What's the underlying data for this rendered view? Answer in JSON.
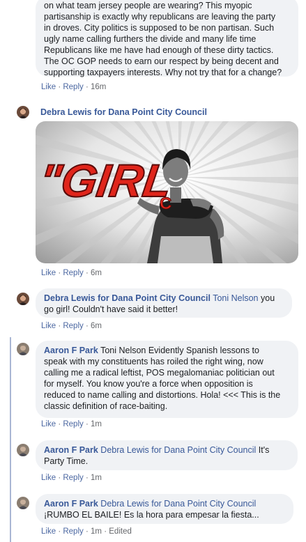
{
  "comments": [
    {
      "text_lines": [
        "on what team jersey people are wearing? This myopic",
        "partisanship is exactly why republicans are leaving the party",
        "in droves. City politics is supposed to be non partisan. Such",
        "ugly name calling furthers the divide and many life time",
        "Republicans like me have had enough of these dirty tactics.",
        "The OC GOP needs to earn our respect by being decent and",
        "supporting taxpayers interests. Why not try that for a change?"
      ],
      "like": "Like",
      "reply": "Reply",
      "time": "16m"
    },
    {
      "author": "Debra Lewis for Dana Point City Council",
      "image_text": "\"GIRL",
      "image_text_small": "C",
      "like": "Like",
      "reply": "Reply",
      "time": "6m"
    },
    {
      "author": "Debra Lewis for Dana Point City Council",
      "mention": "Toni Nelson",
      "text_after_mention": " you",
      "text_lines": [
        "go girl! Couldn't have said it better!"
      ],
      "like": "Like",
      "reply": "Reply",
      "time": "6m"
    },
    {
      "author": "Aaron F Park",
      "text_lines": [
        "Toni Nelson Evidently Spanish lessons to",
        "speak with my constituents has roiled the right wing, now",
        "calling me a radical leftist, POS megalomaniac politician out",
        "for myself. You know you're a force when opposition is",
        "reduced to name calling and distortions. Hola! <<< This is the",
        "classic definition of race-baiting."
      ],
      "like": "Like",
      "reply": "Reply",
      "time": "1m"
    },
    {
      "author": "Aaron F Park",
      "mention": "Debra Lewis for Dana Point City Council",
      "text_after_mention": " It's",
      "text_lines": [
        "Party Time."
      ],
      "like": "Like",
      "reply": "Reply",
      "time": "1m"
    },
    {
      "author": "Aaron F Park",
      "mention": "Debra Lewis for Dana Point City Council",
      "text_lines": [
        "¡RUMBO EL BAILE! Es la hora para empesar la fiesta..."
      ],
      "like": "Like",
      "reply": "Reply",
      "time": "1m",
      "edited": "Edited"
    }
  ],
  "separator": "·",
  "colors": {
    "link": "#385898",
    "bubble": "#f0f2f5",
    "meta": "#65676b",
    "thread_line": "#a9b6d4",
    "image_red": "#e0251b"
  },
  "icons": {
    "avatar_debra": "debra-avatar",
    "avatar_aaron": "aaron-avatar"
  }
}
